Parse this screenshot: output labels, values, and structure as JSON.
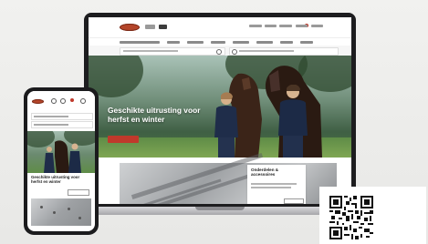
{
  "laptop": {
    "nav": {
      "tabs": [
        "",
        ""
      ],
      "user_nav": [
        "",
        "",
        "",
        "",
        ""
      ],
      "categories": [
        "",
        "",
        "",
        "",
        "",
        "",
        "",
        ""
      ]
    },
    "search": {
      "placeholder_main": "",
      "placeholder_secondary": ""
    },
    "hero": {
      "title": "Geschikte uitrusting voor herfst en winter",
      "button_label": ""
    },
    "card": {
      "title": "Onderdelen & accessoires",
      "button_label": ""
    }
  },
  "phone": {
    "search_placeholder_1": "",
    "search_placeholder_2": "",
    "text": "Geschikte uitrusting voor herfst en winter",
    "button_label": ""
  },
  "colors": {
    "brand_red": "#c0392b",
    "logo": "#b4452a",
    "hero_green": "#5f8c47"
  },
  "icons": [
    "search-icon",
    "user-icon",
    "cart-icon",
    "flag-icon",
    "menu-icon",
    "qr-code"
  ]
}
